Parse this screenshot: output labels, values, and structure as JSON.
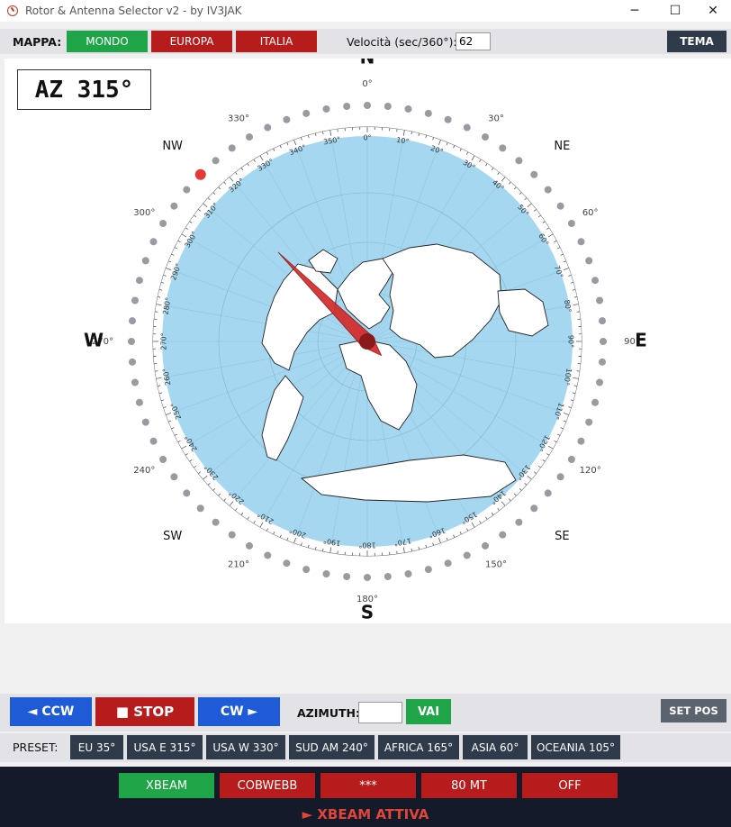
{
  "window": {
    "title": "Rotor & Antenna Selector v2 - by IV3JAK",
    "minimize": "─",
    "maximize": "☐",
    "close": "✕"
  },
  "toolbar": {
    "map_label": "MAPPA:",
    "map_buttons": [
      "MONDO",
      "EUROPA",
      "ITALIA"
    ],
    "speed_label": "Velocità (sec/360°):",
    "speed_value": "62",
    "theme_label": "TEMA"
  },
  "compass": {
    "az_display": "AZ 315°",
    "azimuth_deg": 315,
    "cardinals": {
      "n": "N",
      "s": "S",
      "e": "E",
      "w": "W"
    },
    "intercardinals": {
      "nw": "NW",
      "ne": "NE",
      "sw": "SW",
      "se": "SE"
    },
    "outer_labels": [
      "0°",
      "30°",
      "60°",
      "90°",
      "120°",
      "150°",
      "180°",
      "210°",
      "240°",
      "270°",
      "300°",
      "330°"
    ],
    "ring_labels": [
      "0°",
      "10°",
      "20°",
      "30°",
      "40°",
      "50°",
      "60°",
      "70°",
      "80°",
      "90°",
      "100°",
      "110°",
      "120°",
      "130°",
      "140°",
      "150°",
      "160°",
      "170°",
      "180°",
      "190°",
      "200°",
      "210°",
      "220°",
      "230°",
      "240°",
      "250°",
      "260°",
      "270°",
      "280°",
      "290°",
      "300°",
      "310°",
      "320°",
      "330°",
      "340°",
      "350°"
    ],
    "colors": {
      "ocean": "#a5d8f0",
      "land": "#ffffff",
      "needle": "#d42a2a",
      "dot": "#9a9aa2",
      "active_dot": "#e53935"
    }
  },
  "controls": {
    "ccw": "◄ CCW",
    "stop": "■ STOP",
    "cw": "CW ►",
    "azimuth_label": "AZIMUTH:",
    "azimuth_value": "",
    "go": "VAI",
    "set_pos": "SET POS"
  },
  "presets": {
    "label": "PRESET:",
    "items": [
      "EU 35°",
      "USA E 315°",
      "USA W 330°",
      "SUD AM 240°",
      "AFRICA 165°",
      "ASIA 60°",
      "OCEANIA 105°"
    ]
  },
  "antennas": {
    "items": [
      "XBEAM",
      "COBWEBB",
      "***",
      "80 MT",
      "OFF"
    ],
    "status": "► XBEAM ATTIVA"
  }
}
